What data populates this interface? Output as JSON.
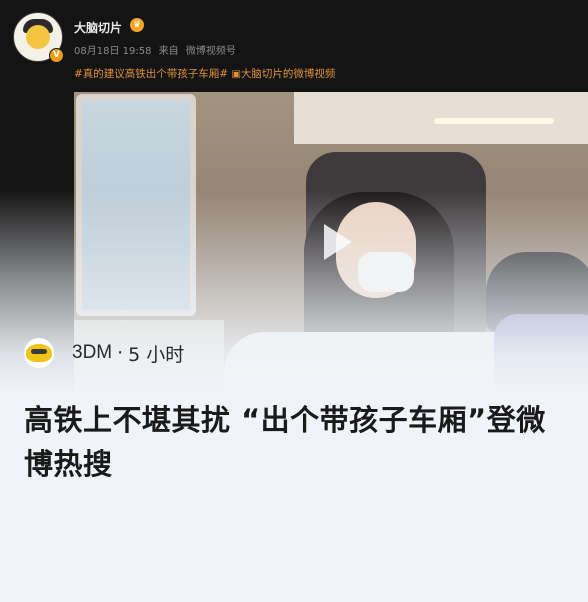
{
  "screenshot": {
    "username": "大脑切片",
    "verified_badge": "V",
    "meta_date": "08月18日 19:58",
    "meta_from": "来自",
    "meta_device": "微博视频号",
    "hashtags": "#真的建议高铁出个带孩子车厢#",
    "video_link": "大脑切片的微博视频"
  },
  "source": {
    "name": "3DM",
    "separator": "·",
    "time_ago": "5 小时",
    "icon": "news-avatar-icon"
  },
  "headline": "高铁上不堪其扰 “出个带孩子车厢”登微博热搜",
  "colors": {
    "background": "#f0f4f8",
    "tag_orange": "#e0913a",
    "headline": "#1a1a1a"
  }
}
